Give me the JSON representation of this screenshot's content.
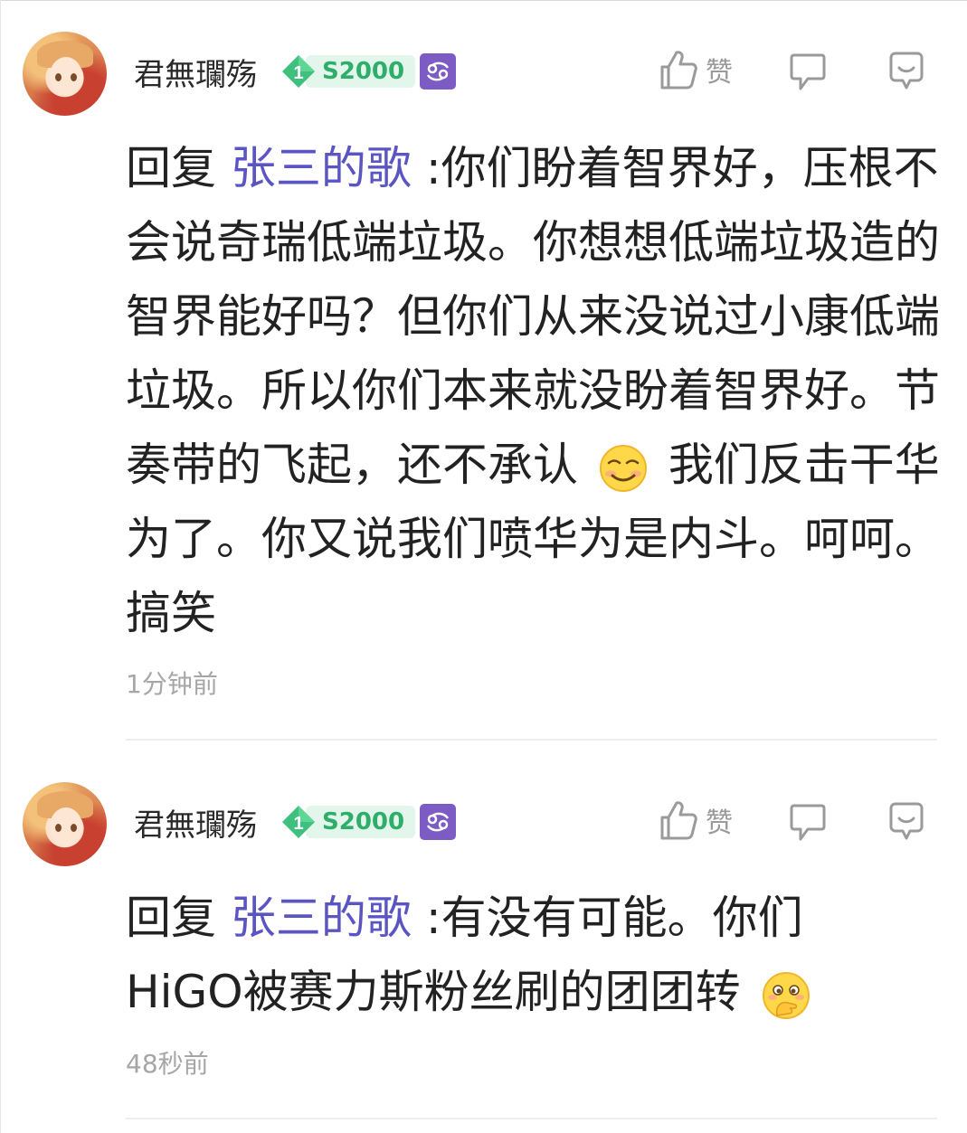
{
  "comments": [
    {
      "username": "君無瓓殇",
      "level": "1",
      "score": "S2000",
      "like_label": "赞",
      "reply_prefix": "回复",
      "mention": "张三的歌",
      "text_part1": ":你们盼着智界好，压根不会说奇瑞低端垃圾。你想想低端垃圾造的智界能好吗？但你们从来没说过小康低端垃圾。所以你们本来就没盼着智界好。节奏带的飞起，还不承认",
      "emoji": "smug-smile-emoji",
      "text_part2": "我们反击干华为了。你又说我们喷华为是内斗。呵呵。搞笑",
      "time": "1分钟前"
    },
    {
      "username": "君無瓓殇",
      "level": "1",
      "score": "S2000",
      "like_label": "赞",
      "reply_prefix": "回复",
      "mention": "张三的歌",
      "text_part1": ":有没有可能。你们HiGO被赛力斯粉丝刷的团团转",
      "emoji": "covering-mouth-emoji",
      "time": "48秒前"
    }
  ],
  "colors": {
    "mention": "#5b55c4",
    "badge_green": "#2fae6a",
    "badge_bg": "#e3f6ec",
    "zodiac_bg": "#7c5cc4",
    "icon_gray": "#9a9a9a"
  }
}
